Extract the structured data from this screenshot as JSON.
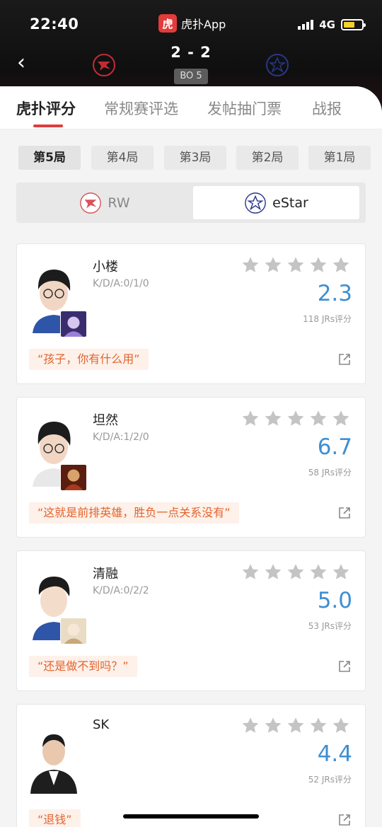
{
  "status_bar": {
    "time": "22:40",
    "app_logo_char": "虎",
    "app_name": "虎扑App",
    "network": "4G"
  },
  "match": {
    "score": "2 - 2",
    "format": "BO 5"
  },
  "tabs": [
    {
      "label": "虎扑评分",
      "active": true
    },
    {
      "label": "常规赛评选",
      "active": false
    },
    {
      "label": "发帖抽门票",
      "active": false
    },
    {
      "label": "战报",
      "active": false
    }
  ],
  "games": [
    {
      "label": "第5局",
      "active": true
    },
    {
      "label": "第4局",
      "active": false
    },
    {
      "label": "第3局",
      "active": false
    },
    {
      "label": "第2局",
      "active": false
    },
    {
      "label": "第1局",
      "active": false
    }
  ],
  "teams": [
    {
      "name": "RW",
      "active": false
    },
    {
      "name": "eStar",
      "active": true
    }
  ],
  "players": [
    {
      "name": "小楼",
      "kda": "K/D/A:0/1/0",
      "rating": "2.3",
      "votes": "118 JRs评分",
      "quote": "“孩子，你有什么用”"
    },
    {
      "name": "坦然",
      "kda": "K/D/A:1/2/0",
      "rating": "6.7",
      "votes": "58 JRs评分",
      "quote": "“这就是前排英雄，胜负一点关系没有”"
    },
    {
      "name": "清融",
      "kda": "K/D/A:0/2/2",
      "rating": "5.0",
      "votes": "53 JRs评分",
      "quote": "“还是做不到吗？”"
    },
    {
      "name": "SK",
      "kda": "",
      "rating": "4.4",
      "votes": "52 JRs评分",
      "quote": "“退钱”"
    }
  ],
  "colors": {
    "accent_red": "#e03b3b",
    "rating_blue": "#3f8fd2",
    "quote_orange": "#e2642f",
    "battery": "#f4d22b"
  }
}
